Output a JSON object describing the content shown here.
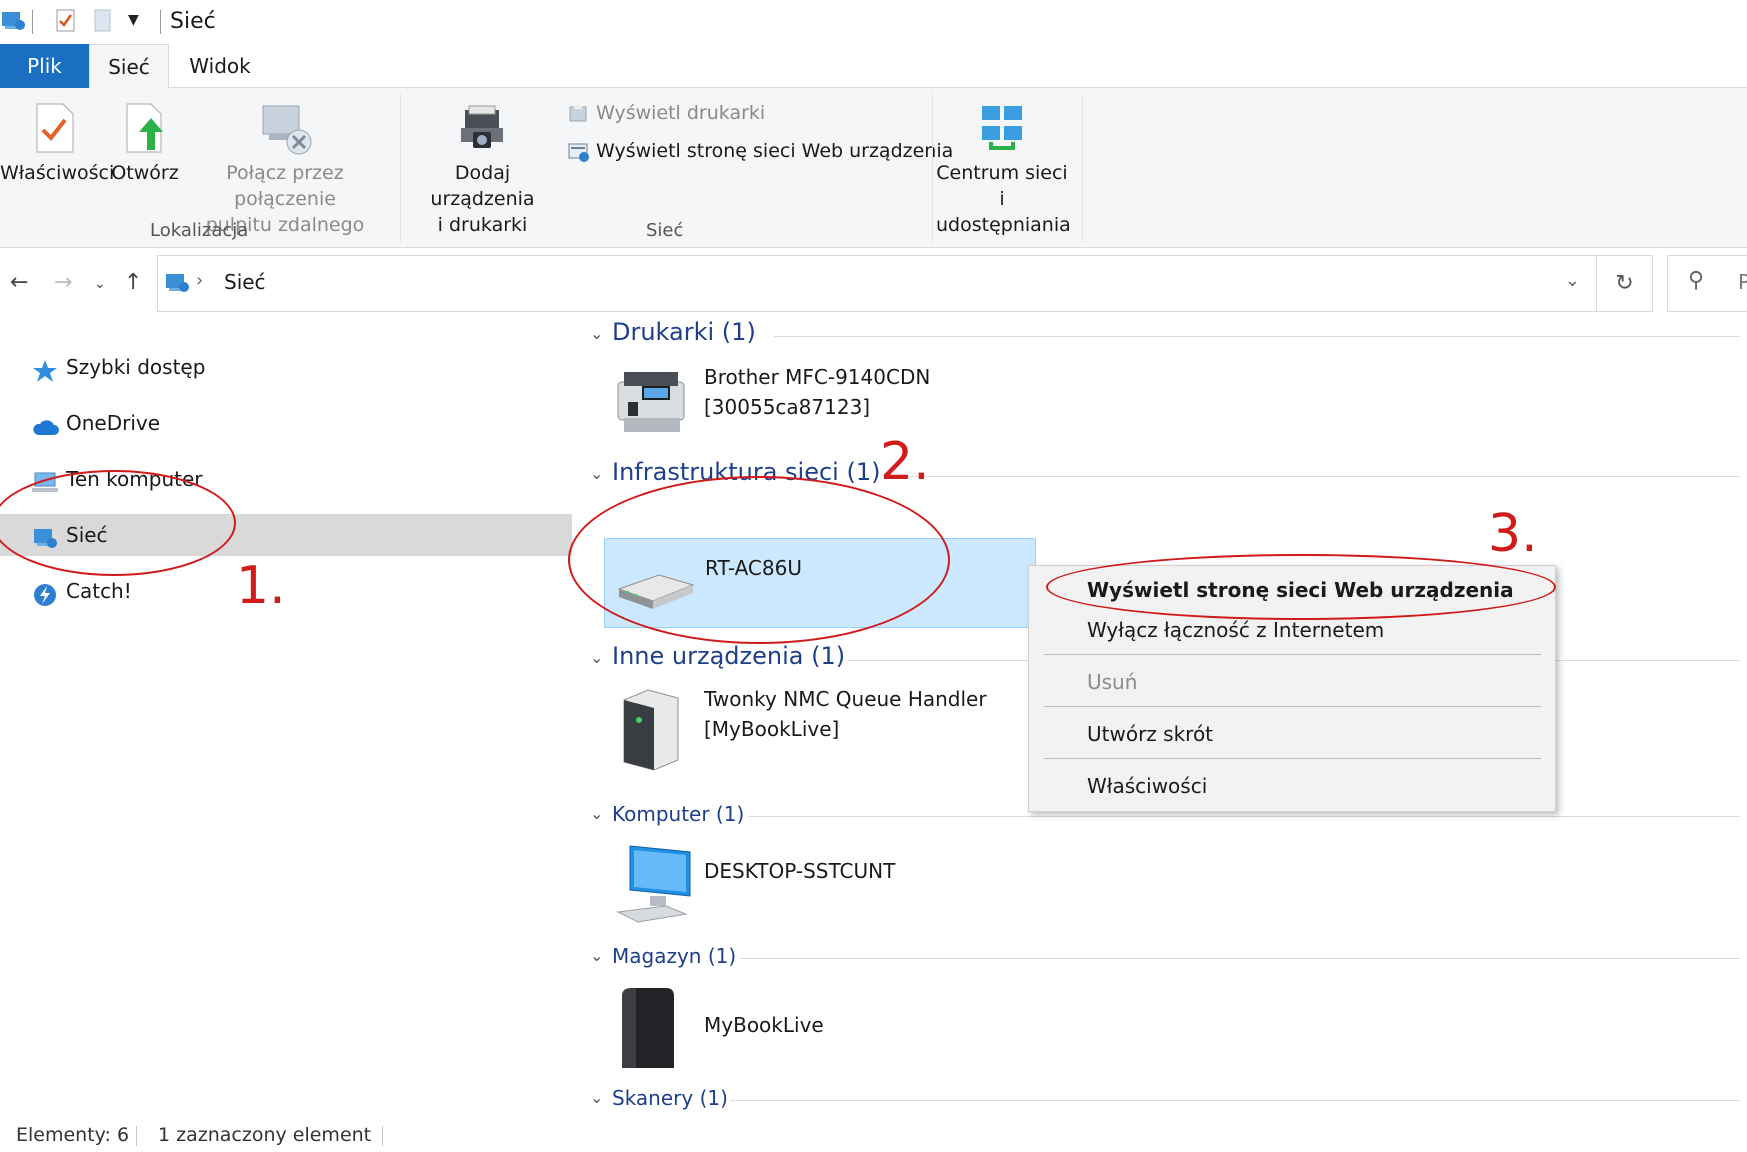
{
  "window": {
    "title": "Sieć"
  },
  "tabs": {
    "plik": "Plik",
    "siec": "Sieć",
    "widok": "Widok"
  },
  "ribbon": {
    "location_group": {
      "label": "Lokalizacja",
      "properties": "Właściwości",
      "open": "Otwórz",
      "remote_line1": "Połącz przez połączenie",
      "remote_line2": "pulpitu zdalnego"
    },
    "network_group": {
      "label": "Sieć",
      "add_line1": "Dodaj urządzenia",
      "add_line2": "i drukarki",
      "show_printers": "Wyświetl drukarki",
      "show_web": "Wyświetl stronę sieci Web urządzenia"
    },
    "center": {
      "line1": "Centrum sieci i",
      "line2": "udostępniania"
    }
  },
  "address": {
    "crumb": "Sieć",
    "search_placeholder": "P"
  },
  "nav": {
    "quick_access": "Szybki dostęp",
    "onedrive": "OneDrive",
    "this_pc": "Ten komputer",
    "network": "Sieć",
    "catch": "Catch!"
  },
  "groups": {
    "printers": {
      "header": "Drukarki (1)",
      "item_line1": "Brother MFC-9140CDN",
      "item_line2": "[30055ca87123]"
    },
    "infra": {
      "header": "Infrastruktura sieci (1)",
      "item_line1": "RT-AC86U"
    },
    "other": {
      "header": "Inne urządzenia (1)",
      "item_line1": "Twonky NMC Queue Handler",
      "item_line2": "[MyBookLive]"
    },
    "computer": {
      "header": "Komputer (1)",
      "item_line1": "DESKTOP-SSTCUNT"
    },
    "storage": {
      "header": "Magazyn (1)",
      "item_line1": "MyBookLive"
    },
    "scanners": {
      "header": "Skanery (1)"
    }
  },
  "context_menu": {
    "show_web": "Wyświetl stronę sieci Web urządzenia",
    "disconnect": "Wyłącz łączność z Internetem",
    "delete": "Usuń",
    "shortcut": "Utwórz skrót",
    "properties": "Właściwości"
  },
  "annotations": {
    "n1": "1.",
    "n2": "2.",
    "n3": "3."
  },
  "status": {
    "count": "Elementy: 6",
    "selected": "1 zaznaczony element"
  },
  "colors": {
    "accent": "#1a6fc2",
    "header_text": "#1e3f8a",
    "selection": "#cce8ff",
    "annotation": "#d11a1a"
  }
}
